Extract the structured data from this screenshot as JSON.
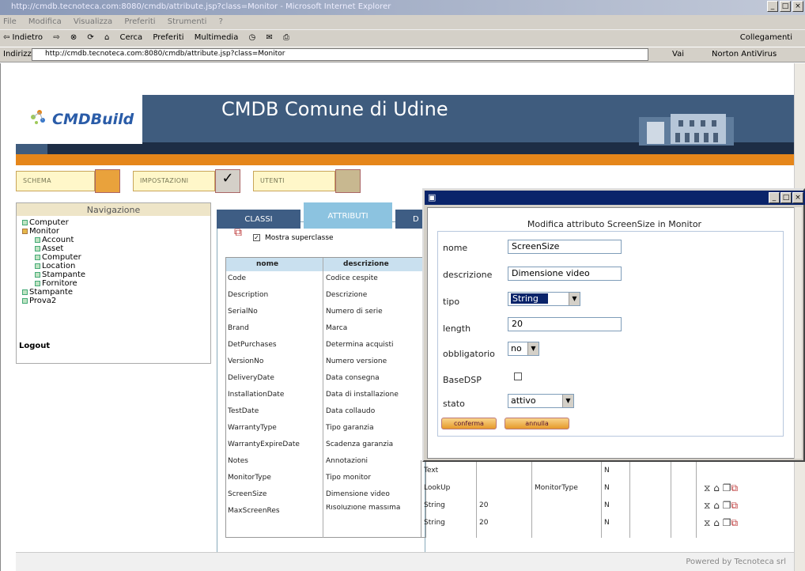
{
  "window": {
    "title": "http://cmdb.tecnoteca.com:8080/cmdb/attribute.jsp?class=Monitor - Microsoft Internet Explorer",
    "min": "_",
    "max": "□",
    "close": "×"
  },
  "menu": [
    "File",
    "Modifica",
    "Visualizza",
    "Preferiti",
    "Strumenti",
    "?"
  ],
  "toolbar": {
    "back": "⇦ Indietro",
    "forward": "⇨",
    "search": "Cerca",
    "favorites": "Preferiti",
    "multimedia": "Multimedia",
    "links": "Collegamenti"
  },
  "address": {
    "label": "Indirizzo",
    "url": "http://cmdb.tecnoteca.com:8080/cmdb/attribute.jsp?class=Monitor",
    "go": "Vai",
    "norton": "Norton AntiVirus"
  },
  "site": {
    "logo": "CMDBuild",
    "title": "CMDB Comune di Udine"
  },
  "modules": [
    {
      "label": "SCHEMA"
    },
    {
      "label": "IMPOSTAZIONI"
    },
    {
      "label": "UTENTI"
    }
  ],
  "nav": {
    "title": "Navigazione",
    "items": [
      {
        "label": "Computer",
        "level": 0
      },
      {
        "label": "Monitor",
        "level": 0
      },
      {
        "label": "Account",
        "level": 1
      },
      {
        "label": "Asset",
        "level": 1
      },
      {
        "label": "Computer",
        "level": 1
      },
      {
        "label": "Location",
        "level": 1
      },
      {
        "label": "Stampante",
        "level": 1
      },
      {
        "label": "Fornitore",
        "level": 1
      },
      {
        "label": "Stampante",
        "level": 0
      },
      {
        "label": "Prova2",
        "level": 0
      }
    ],
    "logout": "Logout"
  },
  "tabs": {
    "classi": "CLASSI",
    "attributi": "ATTRIBUTI",
    "d": "D"
  },
  "superclass_label": "Mostra superclasse",
  "grid": {
    "headers": [
      "nome",
      "descrizione"
    ],
    "rows": [
      [
        "Code",
        "Codice cespite"
      ],
      [
        "Description",
        "Descrizione"
      ],
      [
        "SerialNo",
        "Numero di serie"
      ],
      [
        "Brand",
        "Marca"
      ],
      [
        "DetPurchases",
        "Determina acquisti"
      ],
      [
        "VersionNo",
        "Numero versione"
      ],
      [
        "DeliveryDate",
        "Data consegna"
      ],
      [
        "InstallationDate",
        "Data di installazione"
      ],
      [
        "TestDate",
        "Data collaudo"
      ],
      [
        "WarrantyType",
        "Tipo garanzia"
      ],
      [
        "WarrantyExpireDate",
        "Scadenza garanzia"
      ],
      [
        "Notes",
        "Annotazioni"
      ],
      [
        "MonitorType",
        "Tipo monitor"
      ],
      [
        "ScreenSize",
        "Dimensione video"
      ],
      [
        "MaxScreenRes",
        "Risoluzione massima"
      ]
    ],
    "extra": [
      {
        "tipo": "Text",
        "length": "",
        "lookup": "",
        "flag": "N"
      },
      {
        "tipo": "LookUp",
        "length": "",
        "lookup": "MonitorType",
        "flag": "N"
      },
      {
        "tipo": "String",
        "length": "20",
        "lookup": "",
        "flag": "N"
      },
      {
        "tipo": "String",
        "length": "20",
        "lookup": "",
        "flag": "N"
      }
    ]
  },
  "popup": {
    "caption": "Modifica attributo ScreenSize in Monitor",
    "fields": {
      "nome_label": "nome",
      "nome_value": "ScreenSize",
      "descrizione_label": "descrizione",
      "descrizione_value": "Dimensione video",
      "tipo_label": "tipo",
      "tipo_value": "String",
      "length_label": "length",
      "length_value": "20",
      "obbligatorio_label": "obbligatorio",
      "obbligatorio_value": "no",
      "basedsp_label": "BaseDSP",
      "stato_label": "stato",
      "stato_value": "attivo"
    },
    "confirm": "conferma",
    "cancel": "annulla"
  },
  "footer": "Powered by Tecnoteca srl",
  "colors": {
    "header": "#3f5c7e",
    "accent": "#e5861a",
    "popup_titlebar": "#0a246a"
  }
}
